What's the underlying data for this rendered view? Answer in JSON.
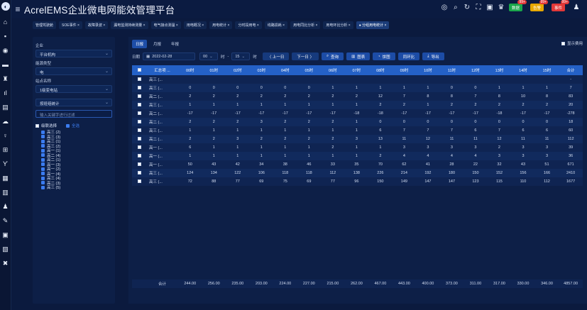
{
  "header": {
    "title": "AcrelEMS企业微电网能效管理平台",
    "badges": [
      {
        "label": "数据",
        "color": "#1aa64b",
        "count": "99+"
      },
      {
        "label": "告警",
        "color": "#e6a700",
        "count": "99+"
      },
      {
        "label": "事件",
        "color": "#e23838",
        "count": "99+"
      }
    ]
  },
  "nav_tabs": [
    "管理驾驶舱",
    "SOE事件 ×",
    "故障录波 ×",
    "漏电监测持续测量 ×",
    "电气接点测温 ×",
    "用电概况 ×",
    "用电统计 ×",
    "分时段用电 ×",
    "线路损耗 ×",
    "用电同比分析 ×",
    "用电环比分析 ×",
    "● 分组用电统计 ×"
  ],
  "sidebar": {
    "enterprise_label": "企业",
    "enterprise_value": "平台机构",
    "energy_label": "能源类型",
    "energy_value": "电",
    "station_label": "站点名称",
    "station_value": "1级变电站",
    "stat_value": "按班组统计",
    "search_placeholder": "输入关键字进行过滤",
    "cascade_label": "级联选择",
    "selectall_label": "全选",
    "tree": [
      "高三 (2)",
      "高三 (3)",
      "高三 (1)",
      "高三 (2)",
      "高一 (1)",
      "高二 (4)",
      "高二 (1)",
      "高一 (3)",
      "高一 (2)",
      "高一 (4)",
      "高三 (4)",
      "高二 (3)",
      "高三 (5)"
    ]
  },
  "main": {
    "tabs": [
      "日报",
      "月报",
      "年报"
    ],
    "show_all": "显示费用",
    "date_label": "日期",
    "date_value": "2022-02-28",
    "hour_from": "00",
    "hour_to": "15",
    "hour_unit": "时",
    "buttons": {
      "prev": "〈 上一日",
      "next": "下一日 〉",
      "query": "查询",
      "chart": "图表",
      "pie": "饼图",
      "compare": "同环比",
      "export": "导出"
    },
    "columns": [
      "汇总项 ...",
      "00时",
      "01时",
      "02时",
      "03时",
      "04时",
      "05时",
      "06时",
      "07时",
      "08时",
      "09时",
      "10时",
      "11时",
      "12时",
      "13时",
      "14时",
      "15时",
      "合计"
    ],
    "rows": [
      [
        "高三 (...",
        "",
        "",
        "",
        "",
        "",
        "",
        "",
        "",
        "",
        "",
        "",
        "",
        "",
        "",
        "",
        "",
        "-"
      ],
      [
        "高三 (...",
        "0",
        "0",
        "0",
        "0",
        "0",
        "0",
        "1",
        "1",
        "1",
        "1",
        "1",
        "0",
        "0",
        "1",
        "1",
        "1",
        "7"
      ],
      [
        "高二 (...",
        "2",
        "2",
        "2",
        "2",
        "2",
        "2",
        "2",
        "2",
        "12",
        "7",
        "8",
        "8",
        "7",
        "8",
        "10",
        "8",
        "83"
      ],
      [
        "高三 (...",
        "1",
        "1",
        "1",
        "1",
        "1",
        "1",
        "1",
        "1",
        "2",
        "2",
        "1",
        "2",
        "2",
        "2",
        "2",
        "2",
        "20"
      ],
      [
        "高二 (...",
        "-17",
        "-17",
        "-17",
        "-17",
        "-17",
        "-17",
        "-17",
        "-18",
        "-18",
        "-17",
        "-17",
        "-17",
        "-17",
        "-18",
        "-17",
        "-17",
        "-278"
      ],
      [
        "高二 (...",
        "2",
        "2",
        "2",
        "3",
        "2",
        "2",
        "2",
        "1",
        "0",
        "0",
        "0",
        "0",
        "0",
        "0",
        "0",
        "0",
        "18"
      ],
      [
        "高三 (...",
        "1",
        "1",
        "1",
        "1",
        "1",
        "1",
        "1",
        "1",
        "6",
        "7",
        "7",
        "7",
        "6",
        "7",
        "6",
        "6",
        "60"
      ],
      [
        "高二 (...",
        "2",
        "2",
        "3",
        "2",
        "2",
        "2",
        "2",
        "3",
        "13",
        "11",
        "12",
        "11",
        "11",
        "12",
        "11",
        "11",
        "112"
      ],
      [
        "高一 (...",
        "6",
        "1",
        "1",
        "1",
        "1",
        "1",
        "2",
        "1",
        "1",
        "3",
        "3",
        "3",
        "3",
        "2",
        "3",
        "3",
        "39"
      ],
      [
        "高一 (...",
        "1",
        "1",
        "1",
        "1",
        "1",
        "1",
        "1",
        "1",
        "2",
        "4",
        "4",
        "4",
        "4",
        "3",
        "3",
        "3",
        "36"
      ],
      [
        "高一 (...",
        "50",
        "43",
        "42",
        "34",
        "38",
        "46",
        "33",
        "35",
        "70",
        "62",
        "41",
        "28",
        "22",
        "32",
        "43",
        "51",
        "671"
      ],
      [
        "高三 (...",
        "124",
        "134",
        "122",
        "106",
        "118",
        "118",
        "112",
        "138",
        "226",
        "214",
        "192",
        "180",
        "150",
        "152",
        "156",
        "166",
        "2410"
      ],
      [
        "高三 (...",
        "72",
        "88",
        "77",
        "69",
        "75",
        "69",
        "77",
        "96",
        "150",
        "149",
        "147",
        "147",
        "123",
        "115",
        "110",
        "112",
        "1677"
      ]
    ],
    "totals": [
      "合计",
      "244.00",
      "256.00",
      "235.00",
      "203.00",
      "224.00",
      "227.00",
      "215.00",
      "262.00",
      "467.00",
      "443.00",
      "400.00",
      "373.00",
      "311.00",
      "317.00",
      "330.00",
      "346.00",
      "4857.00"
    ]
  }
}
